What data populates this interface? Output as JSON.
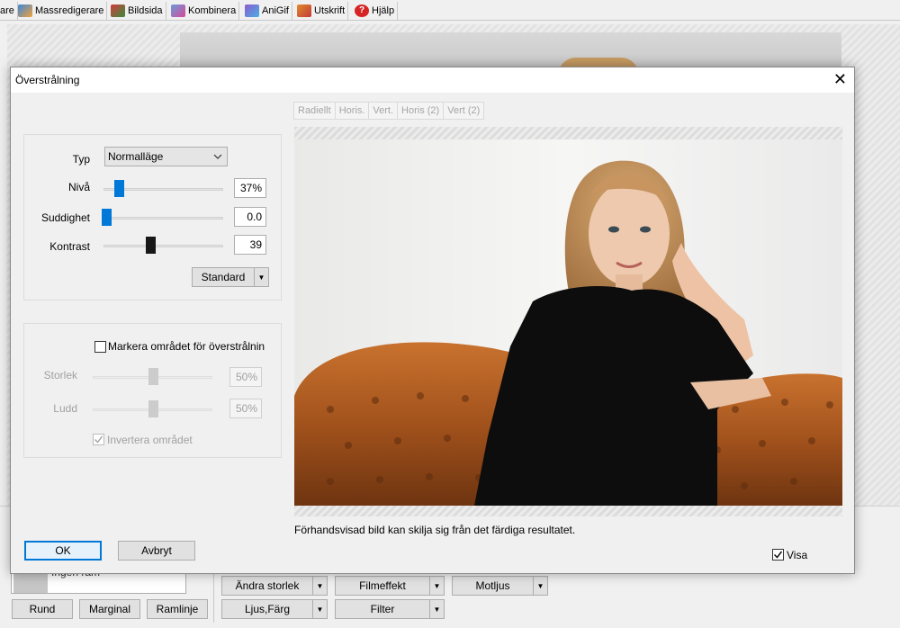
{
  "tabs": [
    {
      "label": "are",
      "icon": ""
    },
    {
      "label": "Massredigerare",
      "icon": "mass-edit-icon"
    },
    {
      "label": "Bildsida",
      "icon": "picture-page-icon"
    },
    {
      "label": "Kombinera",
      "icon": "combine-icon"
    },
    {
      "label": "AniGif",
      "icon": "anigif-icon"
    },
    {
      "label": "Utskrift",
      "icon": "print-icon"
    },
    {
      "label": "Hjälp",
      "icon": "help-icon"
    }
  ],
  "bottom": {
    "frame_value": "Ingen ram",
    "rund": "Rund",
    "marginal": "Marginal",
    "ramlinje": "Ramlinje",
    "andra_storlek": "Ändra storlek",
    "filmeffekt": "Filmeffekt",
    "motljus": "Motljus",
    "ljus_farg": "Ljus,Färg",
    "filter": "Filter"
  },
  "dialog": {
    "title": "Överstrålning",
    "typ_label": "Typ",
    "typ_value": "Normalläge",
    "niva_label": "Nivå",
    "niva_value": "37%",
    "suddighet_label": "Suddighet",
    "suddighet_value": "0.0",
    "kontrast_label": "Kontrast",
    "kontrast_value": "39",
    "standard_label": "Standard",
    "markera_label": "Markera området för överstrålnin",
    "storlek_label": "Storlek",
    "storlek_value": "50%",
    "ludd_label": "Ludd",
    "ludd_value": "50%",
    "invertera_label": "Invertera området",
    "preview_tabs": [
      "Radiellt",
      "Horis.",
      "Vert.",
      "Horis (2)",
      "Vert (2)"
    ],
    "preview_note": "Förhandsvisad bild kan skilja sig från det färdiga resultatet.",
    "visa_label": "Visa",
    "ok_label": "OK",
    "cancel_label": "Avbryt"
  },
  "sliders": {
    "niva": 0.13,
    "suddighet": 0.02,
    "kontrast": 0.39,
    "storlek": 0.5,
    "ludd": 0.5
  },
  "colors": {
    "accent": "#0078d7",
    "ok_border": "#0078d7"
  }
}
